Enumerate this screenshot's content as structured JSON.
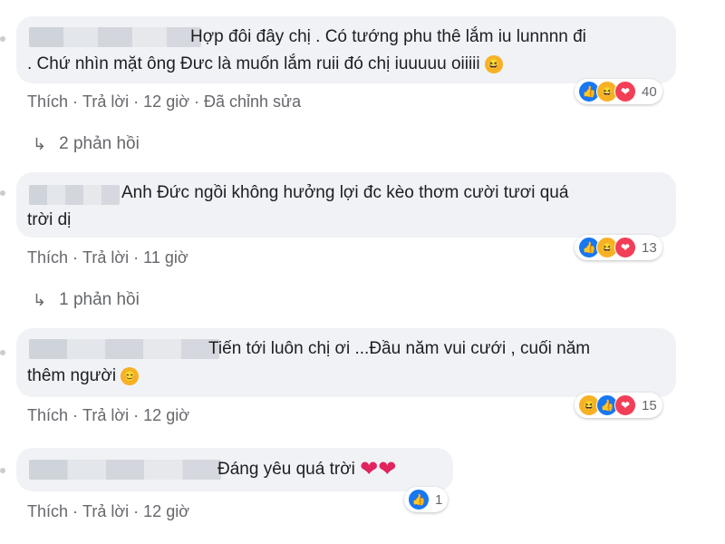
{
  "comments": [
    {
      "text_line1": "Hợp đôi đây chị . Có tướng phu thê lắm iu lunnnn đi",
      "text_line2": ". Chứ nhìn mặt ông Đưc là muốn lắm ruii đó chị iuuuuu oiiiii",
      "like": "Thích",
      "reply": "Trả lời",
      "time": "12 giờ",
      "edited": "Đã chỉnh sửa",
      "reaction_icons": [
        "like-icon",
        "haha-icon",
        "love-icon"
      ],
      "reaction_count": "40",
      "replies": "2 phản hồi"
    },
    {
      "text_line1": "Anh Đức ngồi không hưởng lợi đc kèo thơm cười tươi quá",
      "text_line2": "trời dị",
      "like": "Thích",
      "reply": "Trả lời",
      "time": "11 giờ",
      "reaction_icons": [
        "like-icon",
        "haha-icon",
        "love-icon"
      ],
      "reaction_count": "13",
      "replies": "1 phản hồi"
    },
    {
      "text_line1": "Tiến tới luôn chị ơi ...Đầu năm vui cưới , cuối năm",
      "text_line2": "thêm người",
      "like": "Thích",
      "reply": "Trả lời",
      "time": "12 giờ",
      "reaction_icons": [
        "haha-icon",
        "like-icon",
        "love-icon"
      ],
      "reaction_count": "15"
    },
    {
      "text_line1": "Đáng yêu quá trời",
      "like": "Thích",
      "reply": "Trả lời",
      "time": "12 giờ",
      "reaction_icons": [
        "like-icon"
      ],
      "reaction_count": "1"
    }
  ],
  "colors": {
    "bubble": "#f0f2f5",
    "meta": "#65676b",
    "like": "#1877f2",
    "haha": "#f7b125",
    "love": "#f33e58"
  }
}
